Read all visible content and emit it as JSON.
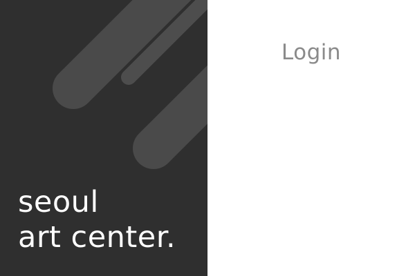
{
  "brand": {
    "line1": "seoul",
    "line2": "art center."
  },
  "login": {
    "title": "Login"
  },
  "colors": {
    "panel_background": "#2f2f2f",
    "stripe": "#4a4a4a",
    "stripe_thin": "#4d4d4d",
    "brand_text": "#ffffff",
    "login_text": "#8a8a8a"
  }
}
